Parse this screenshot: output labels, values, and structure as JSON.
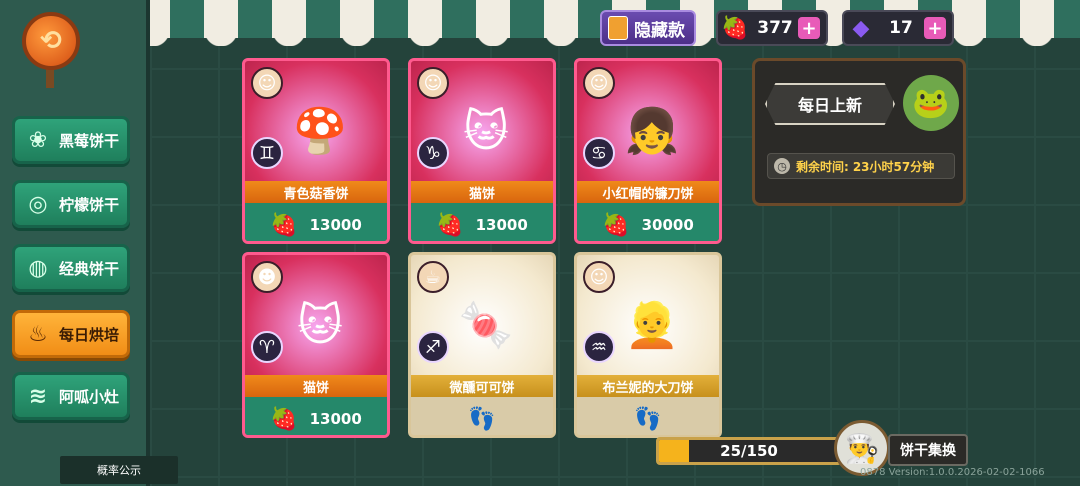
{
  "sidebar": {
    "items": [
      {
        "label": "黑莓饼干",
        "icon": "blackberry-icon",
        "glyph": "❀"
      },
      {
        "label": "柠檬饼干",
        "icon": "lemon-icon",
        "glyph": "◎"
      },
      {
        "label": "经典饼干",
        "icon": "cookie-icon",
        "glyph": "◍"
      },
      {
        "label": "每日烘培",
        "icon": "bread-icon",
        "glyph": "♨"
      },
      {
        "label": "阿呱小灶",
        "icon": "stove-icon",
        "glyph": "≋"
      }
    ],
    "active_index": 3,
    "prob_label": "概率公示"
  },
  "topbar": {
    "hidden_label": "隐藏款",
    "strawberry_count": "377",
    "gem_count": "17"
  },
  "cards": [
    {
      "name": "青色菇香饼",
      "price": "13000",
      "zodiac": "♊",
      "style": "pink",
      "art": "🍄",
      "avatar": "☺",
      "currency": "strawberry"
    },
    {
      "name": "猫饼",
      "price": "13000",
      "zodiac": "♑",
      "style": "pink",
      "art": "🐱",
      "avatar": "☺",
      "currency": "strawberry"
    },
    {
      "name": "小红帽的镰刀饼",
      "price": "30000",
      "zodiac": "♋",
      "style": "pink",
      "art": "👧",
      "avatar": "☺",
      "currency": "strawberry"
    },
    {
      "name": "猫饼",
      "price": "13000",
      "zodiac": "♈",
      "style": "pink",
      "art": "🐱",
      "avatar": "☻",
      "currency": "strawberry"
    },
    {
      "name": "微醺可可饼",
      "price": "",
      "zodiac": "♐",
      "style": "gold",
      "art": "🍬",
      "avatar": "☕",
      "currency": "footprint"
    },
    {
      "name": "布兰妮的大刀饼",
      "price": "",
      "zodiac": "♒",
      "style": "gold",
      "art": "👱",
      "avatar": "☺",
      "currency": "footprint"
    }
  ],
  "daily": {
    "title": "每日上新",
    "remaining_label": "剩余时间:",
    "remaining_time": "23小时57分钟"
  },
  "progress": {
    "current": 25,
    "max": 150,
    "text": "25/150"
  },
  "exchange_label": "饼干集换",
  "version_text": "0878 Version:1.0.0.2026-02-02-1066",
  "colors": {
    "accent_orange": "#f18d16",
    "nav_green": "#2fa37a",
    "card_pink": "#d8305e",
    "card_gold": "#f4e9cf",
    "plus_pink": "#e85bb8"
  }
}
